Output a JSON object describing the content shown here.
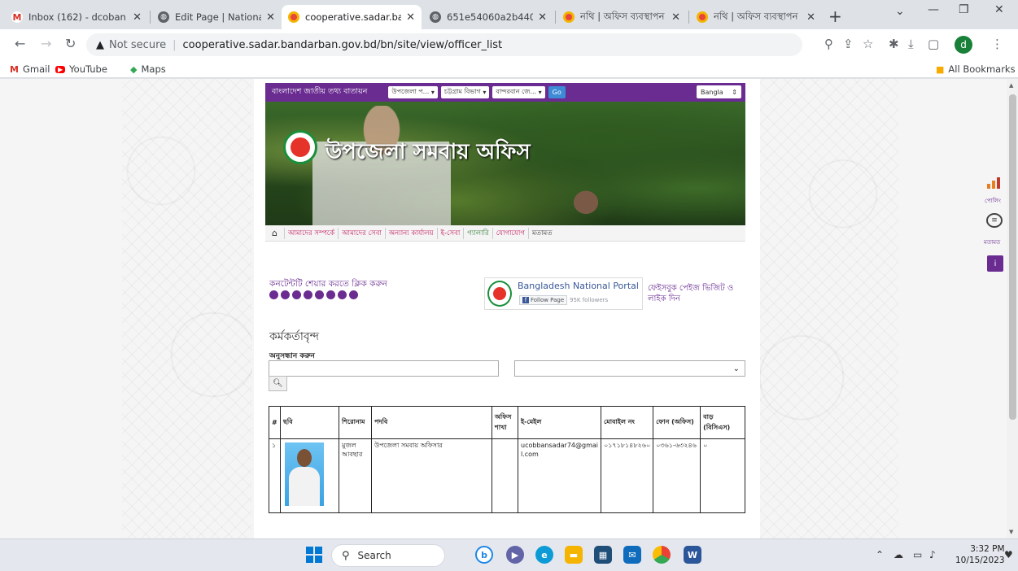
{
  "browser": {
    "tabs": [
      {
        "title": "Inbox (162) - dcoban",
        "favicon": "gmail-icon"
      },
      {
        "title": "Edit Page | National P",
        "favicon": "globe-icon"
      },
      {
        "title": "cooperative.sadar.bar",
        "favicon": "gov-icon",
        "active": true
      },
      {
        "title": "651e54060a2b44086",
        "favicon": "globe-icon"
      },
      {
        "title": "নথি | অফিস ব্যবস্থাপন",
        "favicon": "gov-icon"
      },
      {
        "title": "নথি | অফিস ব্যবস্থাপন",
        "favicon": "gov-icon"
      }
    ],
    "new_tab": "+",
    "address": {
      "not_secure": "Not secure",
      "url": "cooperative.sadar.bandarban.gov.bd/bn/site/view/officer_list"
    },
    "profile_initial": "d",
    "bookmarks": [
      {
        "label": "Gmail",
        "icon": "gmail-icon"
      },
      {
        "label": "YouTube",
        "icon": "youtube-icon"
      },
      {
        "label": "Maps",
        "icon": "maps-icon"
      }
    ],
    "all_bookmarks": "All Bookmarks"
  },
  "site": {
    "portal_title": "বাংলাদেশ জাতীয় তথ্য বাতায়ন",
    "selects": [
      "উপজেলা প...",
      "চট্টগ্রাম বিভাগ",
      "বান্দরবান জে..."
    ],
    "go": "Go",
    "lang": "Bangla",
    "banner_title": "উপজেলা সমবায় অফিস",
    "nav": [
      "আমাদের সম্পর্কে",
      "আমাদের সেবা",
      "অন্যান্য কার্যালয়",
      "ই-সেবা",
      "গ্যালারি",
      "যোগাযোগ",
      "মতামত"
    ],
    "share_text": "কনটেন্টটি শেয়ার করতে ক্লিক করুন",
    "fb": {
      "name": "Bangladesh National Portal",
      "follow": "Follow Page",
      "followers": "95K followers",
      "like_text": "ফেইসবুক পেইজ ভিজিট ও লাইক দিন"
    },
    "page_heading": "কর্মকর্তাবৃন্দ",
    "search_label": "অনুসন্ধান করুন",
    "table": {
      "headers": [
        "#",
        "ছবি",
        "শিরোনাম",
        "পদবি",
        "অফিস শাখা",
        "ই-মেইল",
        "মোবাইল নং",
        "ফোন (অফিস)",
        "বাড় (বিসিএস)"
      ],
      "rows": [
        {
          "no": "১",
          "name": "মুজল আবছার",
          "designation": "উপজেলা সমবায় অফিসার",
          "branch": "",
          "email": "ucobbansadar74@gmail.com",
          "mobile": "০১৭১৮১৪৮২৬০",
          "phone": "০৩৬১-৬৩২৪৬",
          "bcs": "০"
        }
      ]
    },
    "side": {
      "poll": "পোলিং",
      "opinion": "মতামত"
    }
  },
  "taskbar": {
    "search": "Search",
    "time": "3:32 PM",
    "date": "10/15/2023"
  }
}
